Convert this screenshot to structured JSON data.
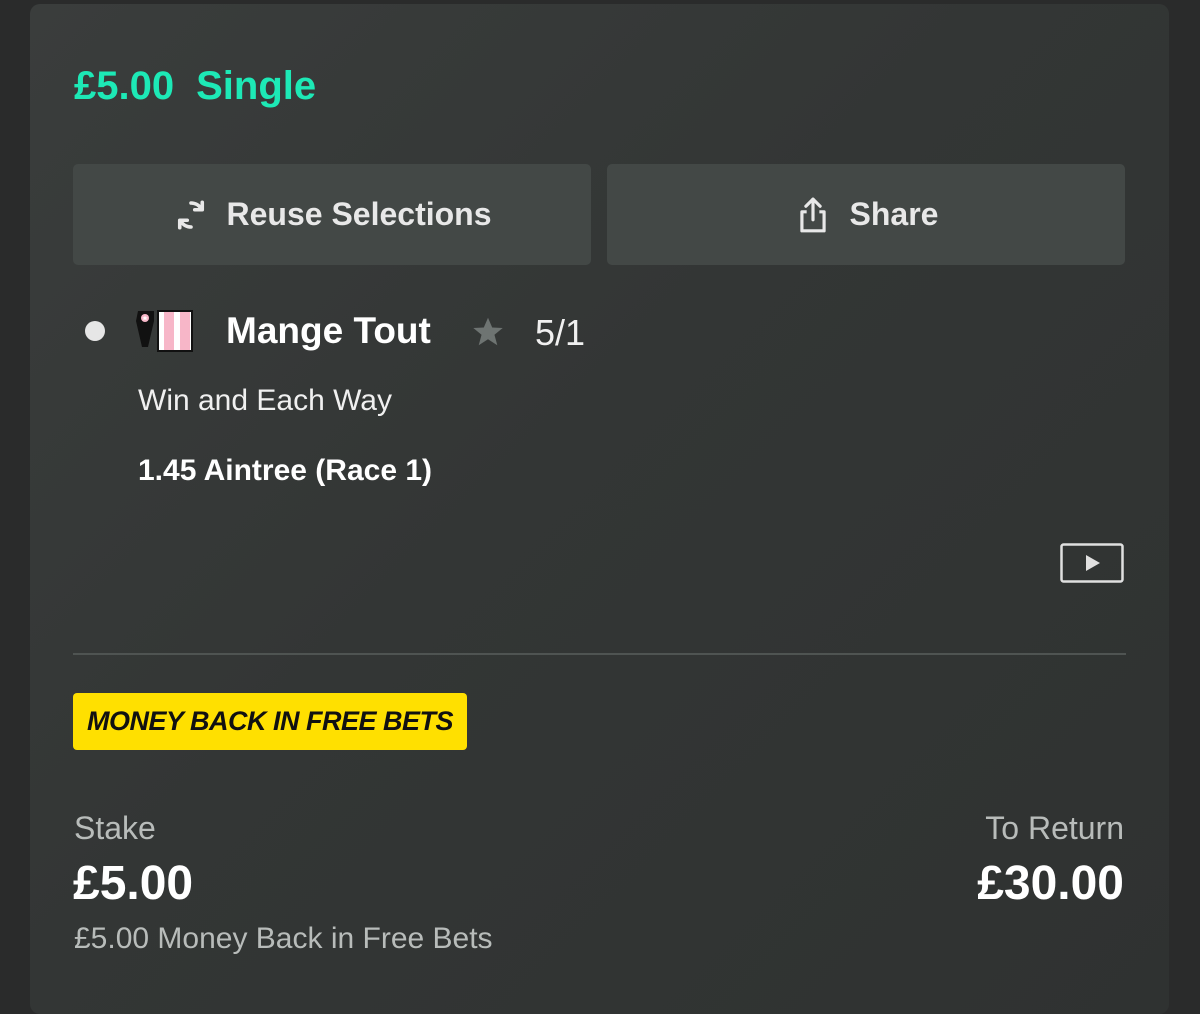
{
  "bet": {
    "stake_amount": "£5.00",
    "bet_type": "Single"
  },
  "actions": {
    "reuse_label": "Reuse Selections",
    "share_label": "Share"
  },
  "selection": {
    "horse_name": "Mange Tout",
    "odds": "5/1",
    "market": "Win and Each Way",
    "event": "1.45 Aintree (Race 1)"
  },
  "promo": {
    "badge_label": "MONEY BACK IN FREE BETS"
  },
  "summary": {
    "stake_label": "Stake",
    "stake_value": "£5.00",
    "stake_note": "£5.00 Money Back in Free Bets",
    "return_label": "To Return",
    "return_value": "£30.00"
  },
  "colors": {
    "accent": "#1de9b6",
    "promo_yellow": "#ffe000",
    "card_bg": "#353837",
    "button_bg": "#434846"
  },
  "icons": {
    "reuse": "refresh-icon",
    "share": "share-icon",
    "favourite": "star-icon",
    "stream": "play-icon"
  }
}
